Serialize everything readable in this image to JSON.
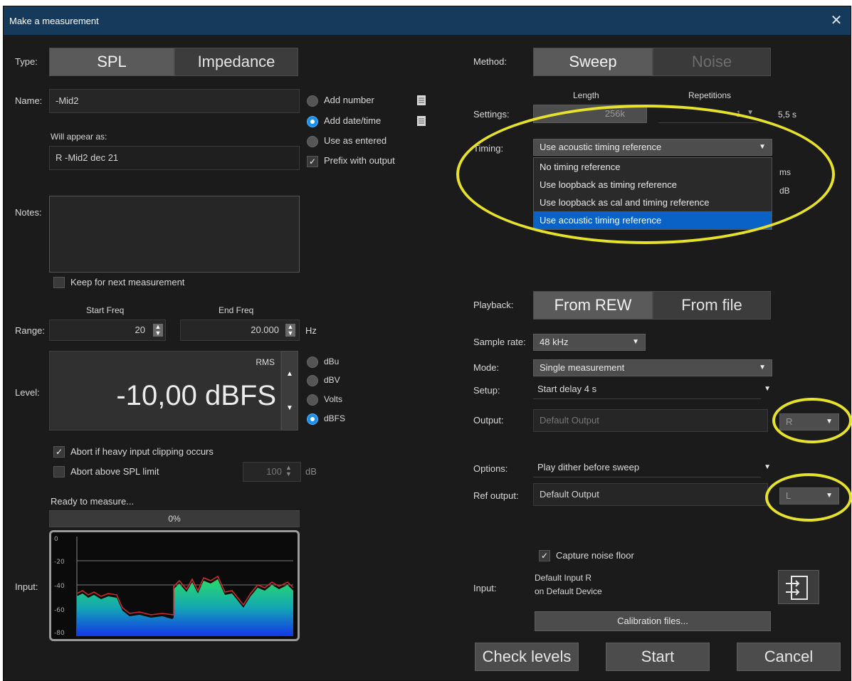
{
  "window": {
    "title": "Make a measurement"
  },
  "left": {
    "type_label": "Type:",
    "type_options": [
      "SPL",
      "Impedance"
    ],
    "name_label": "Name:",
    "name_value": "-Mid2",
    "name_options": [
      {
        "label": "Add number",
        "selected": false
      },
      {
        "label": "Add date/time",
        "selected": true
      },
      {
        "label": "Use as entered",
        "selected": false
      }
    ],
    "prefix_label": "Prefix with output",
    "will_appear_label": "Will appear as:",
    "will_appear_value": "R -Mid2 dec 21",
    "notes_label": "Notes:",
    "keep_label": "Keep for next measurement",
    "range_label": "Range:",
    "start_freq_label": "Start Freq",
    "start_freq_value": "20",
    "end_freq_label": "End Freq",
    "end_freq_value": "20.000",
    "hz_unit": "Hz",
    "level_label": "Level:",
    "rms_label": "RMS",
    "level_value": "-10,00 dBFS",
    "unit_options": [
      {
        "label": "dBu",
        "selected": false
      },
      {
        "label": "dBV",
        "selected": false
      },
      {
        "label": "Volts",
        "selected": false
      },
      {
        "label": "dBFS",
        "selected": true
      }
    ],
    "abort_clip_label": "Abort if heavy input clipping occurs",
    "abort_spl_label": "Abort above SPL limit",
    "spl_limit_value": "100",
    "db_unit": "dB",
    "status": "Ready to measure...",
    "progress_text": "0%",
    "progress_value": 0,
    "input_label": "Input:",
    "meter_ticks": [
      "0",
      "-20",
      "-40",
      "-60",
      "-80"
    ]
  },
  "right": {
    "method_label": "Method:",
    "method_options": [
      "Sweep",
      "Noise"
    ],
    "settings_label": "Settings:",
    "length_label": "Length",
    "length_value": "256k",
    "repetitions_label": "Repetitions",
    "repetitions_value": "1",
    "duration": "5,5 s",
    "timing_label": "Timing:",
    "timing_value": "Use acoustic timing reference",
    "timing_options": [
      "No timing reference",
      "Use loopback as timing reference",
      "Use loopback as cal and timing reference",
      "Use acoustic timing reference"
    ],
    "ms_unit": "ms",
    "db_unit": "dB",
    "playback_label": "Playback:",
    "playback_options": [
      "From REW",
      "From file"
    ],
    "sample_rate_label": "Sample rate:",
    "sample_rate_value": "48 kHz",
    "mode_label": "Mode:",
    "mode_value": "Single measurement",
    "setup_label": "Setup:",
    "setup_value": "Start delay 4 s",
    "output_label": "Output:",
    "output_value": "Default Output",
    "output_channel": "R",
    "options_label": "Options:",
    "options_value": "Play dither before sweep",
    "ref_output_label": "Ref output:",
    "ref_output_value": "Default Output",
    "ref_output_channel": "L",
    "capture_noise_label": "Capture noise floor",
    "input_label": "Input:",
    "input_device_line1": "Default Input R",
    "input_device_line2": "on Default Device",
    "calibration_button": "Calibration files...",
    "check_levels_button": "Check levels",
    "start_button": "Start",
    "cancel_button": "Cancel"
  },
  "colors": {
    "accent": "#1e8fe8",
    "highlight_ellipse": "#e6e22c",
    "titlebar": "#163a5c"
  }
}
